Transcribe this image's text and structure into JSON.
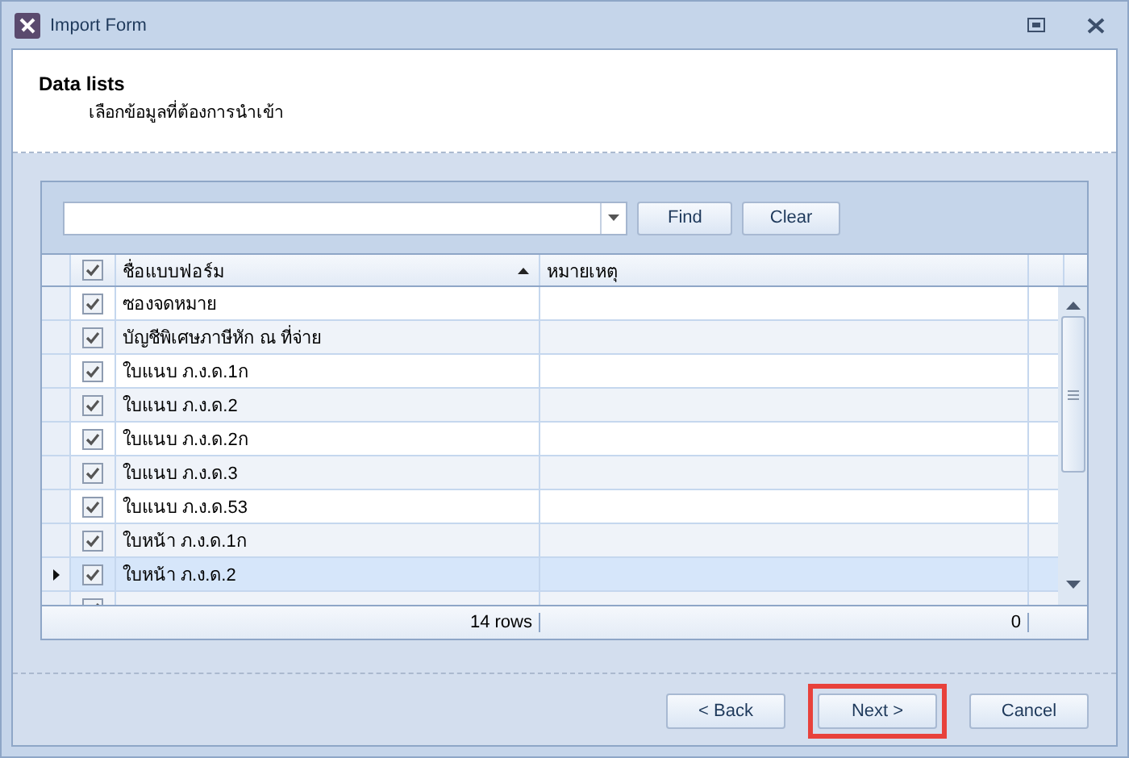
{
  "window": {
    "title": "Import Form"
  },
  "header": {
    "title": "Data lists",
    "subtitle": "เลือกข้อมูลที่ต้องการนำเข้า"
  },
  "search": {
    "find": "Find",
    "clear": "Clear"
  },
  "table": {
    "all_checked": true,
    "columns": [
      {
        "label": "ชื่อแบบฟอร์ม",
        "sorted": true
      },
      {
        "label": "หมายเหตุ",
        "sorted": false
      }
    ],
    "rows": [
      {
        "name": "ซองจดหมาย",
        "checked": true,
        "selected": false
      },
      {
        "name": "บัญชีพิเศษภาษีหัก ณ ที่จ่าย",
        "checked": true,
        "selected": false
      },
      {
        "name": "ใบแนบ ภ.ง.ด.1ก",
        "checked": true,
        "selected": false
      },
      {
        "name": "ใบแนบ ภ.ง.ด.2",
        "checked": true,
        "selected": false
      },
      {
        "name": "ใบแนบ ภ.ง.ด.2ก",
        "checked": true,
        "selected": false
      },
      {
        "name": "ใบแนบ ภ.ง.ด.3",
        "checked": true,
        "selected": false
      },
      {
        "name": "ใบแนบ ภ.ง.ด.53",
        "checked": true,
        "selected": false
      },
      {
        "name": "ใบหน้า ภ.ง.ด.1ก",
        "checked": true,
        "selected": false
      },
      {
        "name": "ใบหน้า ภ.ง.ด.2",
        "checked": true,
        "selected": true
      },
      {
        "checked": true,
        "selected": false
      }
    ],
    "footer": {
      "count": "14 rows",
      "sum": "0"
    }
  },
  "buttons": [
    {
      "label": "< Back",
      "highlighted": false
    },
    {
      "label": "Next >",
      "highlighted": true
    },
    {
      "label": "Cancel",
      "highlighted": false
    }
  ]
}
